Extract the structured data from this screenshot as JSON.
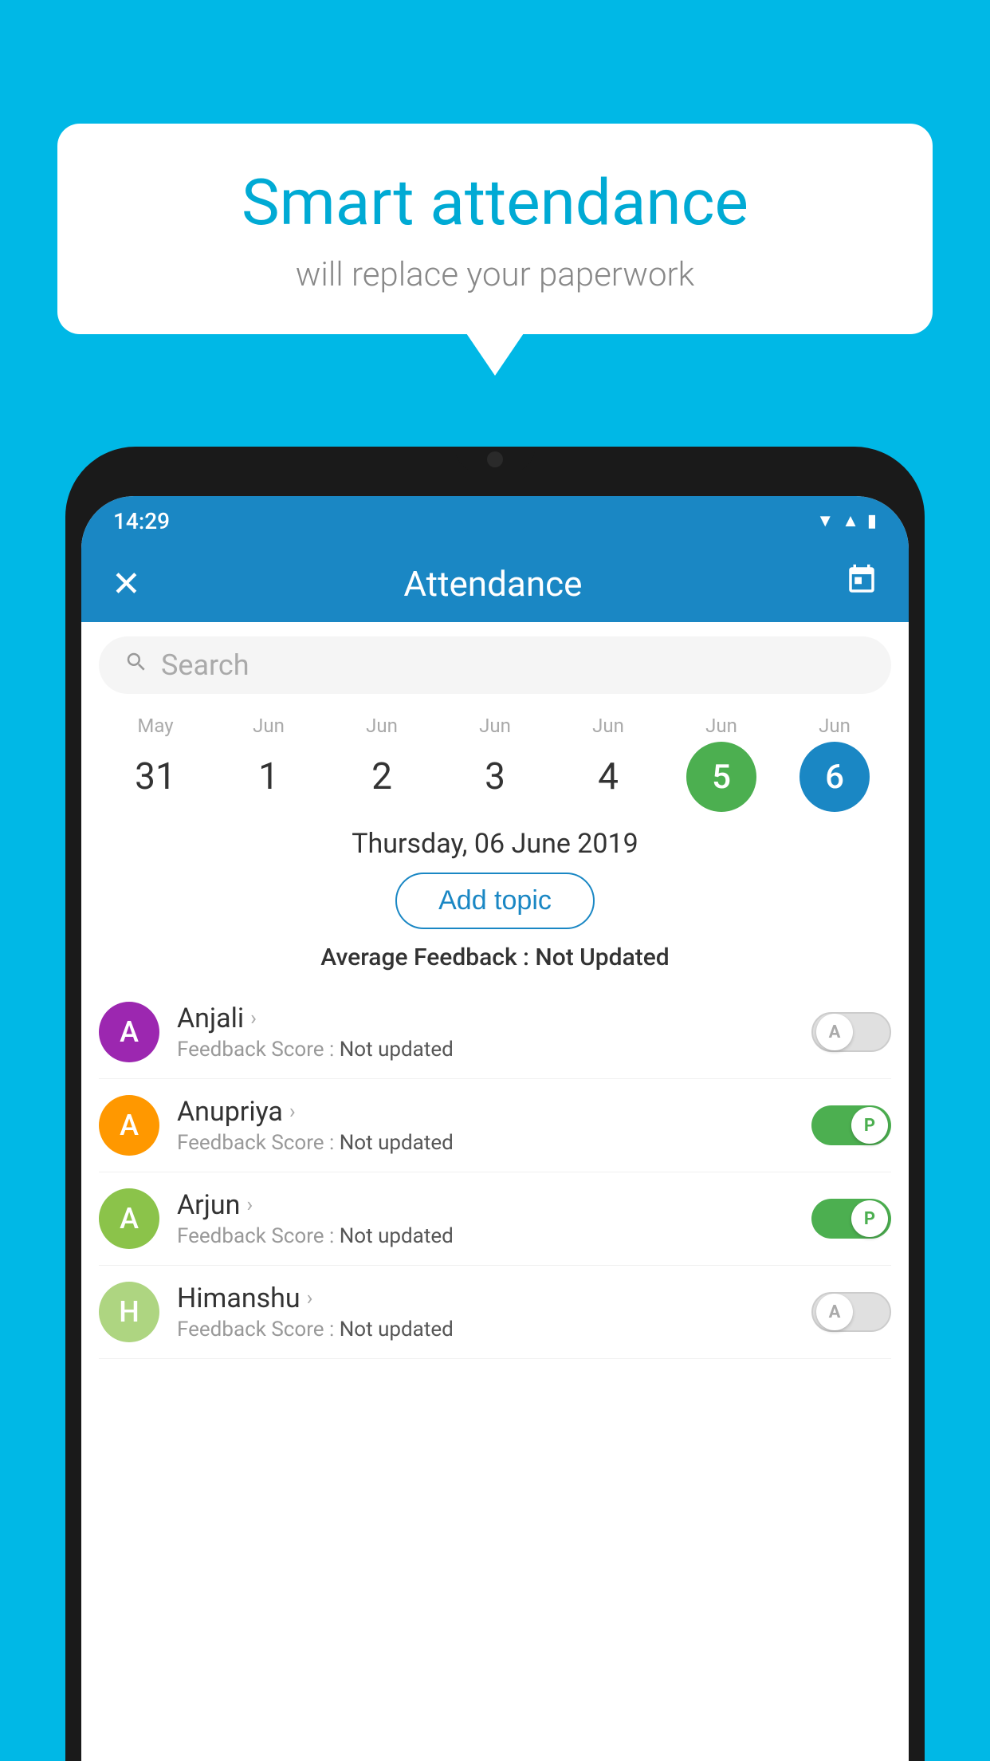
{
  "background_color": "#00b8e6",
  "speech_bubble": {
    "title": "Smart attendance",
    "subtitle": "will replace your paperwork"
  },
  "status_bar": {
    "time": "14:29",
    "wifi_icon": "▼",
    "signal_icon": "▲",
    "battery_icon": "▮"
  },
  "app_header": {
    "title": "Attendance",
    "close_icon": "✕",
    "calendar_icon": "📅"
  },
  "search": {
    "placeholder": "Search"
  },
  "date_picker": {
    "months": [
      "May",
      "Jun",
      "Jun",
      "Jun",
      "Jun",
      "Jun",
      "Jun"
    ],
    "days": [
      "31",
      "1",
      "2",
      "3",
      "4",
      "5",
      "6"
    ],
    "active_green_index": 5,
    "active_blue_index": 6
  },
  "selected_date": {
    "label": "Thursday, 06 June 2019"
  },
  "add_topic": {
    "label": "Add topic"
  },
  "avg_feedback": {
    "label": "Average Feedback : ",
    "value": "Not Updated"
  },
  "students": [
    {
      "name": "Anjali",
      "avatar_letter": "A",
      "avatar_color": "#9c27b0",
      "feedback_label": "Feedback Score : ",
      "feedback_value": "Not updated",
      "toggle": "off",
      "toggle_letter": "A"
    },
    {
      "name": "Anupriya",
      "avatar_letter": "A",
      "avatar_color": "#ff9800",
      "feedback_label": "Feedback Score : ",
      "feedback_value": "Not updated",
      "toggle": "on",
      "toggle_letter": "P"
    },
    {
      "name": "Arjun",
      "avatar_letter": "A",
      "avatar_color": "#8bc34a",
      "feedback_label": "Feedback Score : ",
      "feedback_value": "Not updated",
      "toggle": "on",
      "toggle_letter": "P"
    },
    {
      "name": "Himanshu",
      "avatar_letter": "H",
      "avatar_color": "#aed581",
      "feedback_label": "Feedback Score : ",
      "feedback_value": "Not updated",
      "toggle": "off",
      "toggle_letter": "A"
    }
  ]
}
